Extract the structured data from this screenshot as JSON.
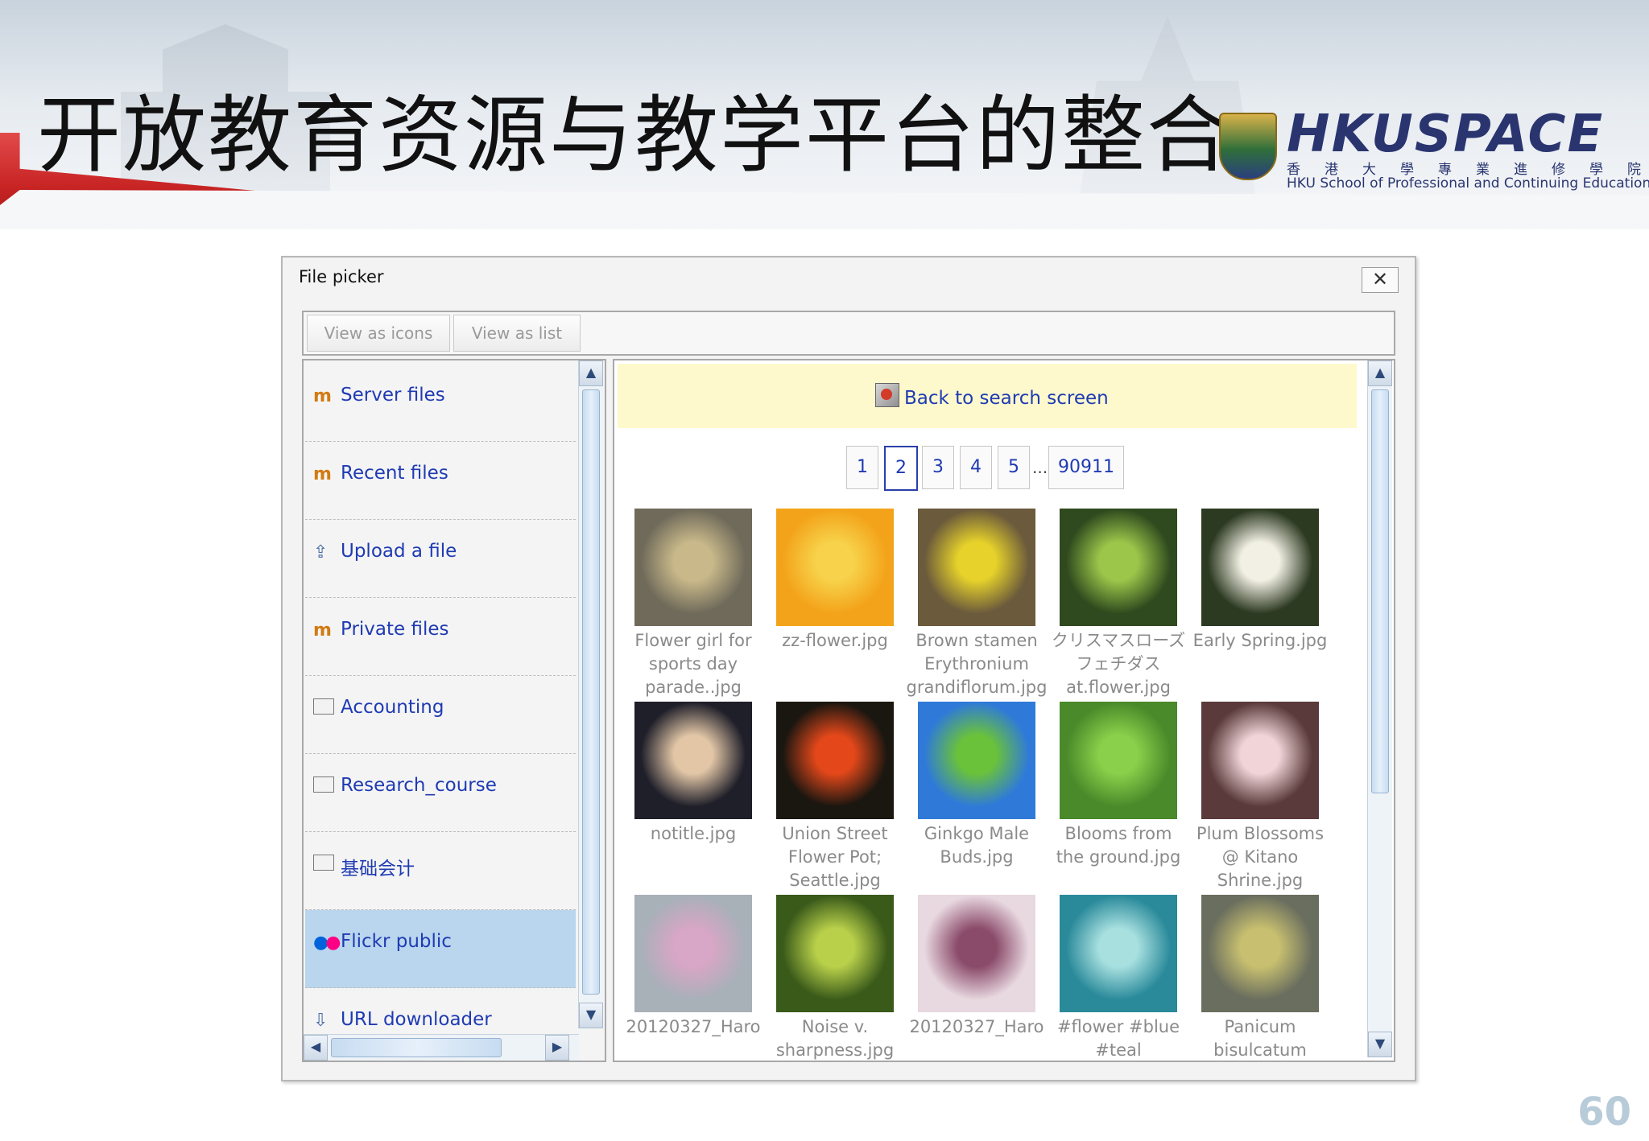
{
  "slide": {
    "title": "开放教育资源与教学平台的整合",
    "logo_text": "HKUSPACE",
    "logo_cn": "香港大學專業進修學院",
    "logo_en": "HKU School of Professional and Continuing Education",
    "page_number": "60"
  },
  "picker": {
    "title": "File picker",
    "close_label": "✕",
    "toolbar": {
      "view_icons": "View as icons",
      "view_list": "View as list"
    },
    "repositories": [
      {
        "label": "Server files",
        "icon": "moodle-icon"
      },
      {
        "label": "Recent files",
        "icon": "moodle-icon"
      },
      {
        "label": "Upload a file",
        "icon": "upload-icon"
      },
      {
        "label": "Private files",
        "icon": "moodle-icon"
      },
      {
        "label": "Accounting",
        "icon": "folder-icon"
      },
      {
        "label": "Research_course",
        "icon": "folder-icon"
      },
      {
        "label": "基础会计",
        "icon": "folder-icon"
      },
      {
        "label": "Flickr public",
        "icon": "flickr-icon",
        "active": true
      },
      {
        "label": "URL downloader",
        "icon": "download-icon"
      }
    ],
    "back_label": "Back to search screen",
    "pages": [
      "1",
      "2",
      "3",
      "4",
      "5"
    ],
    "current_page": "2",
    "ellipsis": "...",
    "last_page": "90911",
    "files": [
      {
        "caption": "Flower girl for\nsports day\nparade..jpg",
        "colors": [
          "#6f6a5a",
          "#c9b98a",
          "#8a8f86"
        ]
      },
      {
        "caption": "zz-flower.jpg",
        "colors": [
          "#f3a31a",
          "#f7d24a",
          "#2d5a1f"
        ]
      },
      {
        "caption": "Brown stamen\nErythronium\ngrandiflorum.jpg",
        "colors": [
          "#6b5a3c",
          "#e6d22a",
          "#8f7a55"
        ]
      },
      {
        "caption": "クリスマスローズ\nフェチダス\nat.flower.jpg",
        "colors": [
          "#2f4a1e",
          "#9bc64a",
          "#5f8a2a"
        ]
      },
      {
        "caption": "Early Spring.jpg",
        "colors": [
          "#2d3a22",
          "#f2f0e4",
          "#7f8f5a"
        ]
      },
      {
        "caption": "notitle.jpg",
        "colors": [
          "#1f1f2a",
          "#e2c6a6",
          "#3a4fb5"
        ]
      },
      {
        "caption": "Union Street\nFlower Pot;\nSeattle.jpg",
        "colors": [
          "#1a1610",
          "#e4481a",
          "#c99a2a"
        ]
      },
      {
        "caption": "Ginkgo Male\nBuds.jpg",
        "colors": [
          "#2f7ad8",
          "#6ac23a",
          "#e6f2fa"
        ]
      },
      {
        "caption": "Blooms from\nthe ground.jpg",
        "colors": [
          "#4a8a2a",
          "#8ad04a",
          "#eef2e8"
        ]
      },
      {
        "caption": "Plum Blossoms\n@ Kitano\nShrine.jpg",
        "colors": [
          "#5a3a3a",
          "#f0d4d8",
          "#3a5aa8"
        ]
      },
      {
        "caption": "20120327_Haro",
        "colors": [
          "#a8b0b8",
          "#d8a6c6",
          "#4a4a42"
        ]
      },
      {
        "caption": "Noise v.\nsharpness.jpg",
        "colors": [
          "#3a5a1a",
          "#b8d04a",
          "#1a2a0a"
        ]
      },
      {
        "caption": "20120327_Haro",
        "colors": [
          "#e8d8e0",
          "#8a4a6a",
          "#4a3a4a"
        ]
      },
      {
        "caption": "#flower #blue\n#teal",
        "colors": [
          "#2a8a9a",
          "#a8e0e0",
          "#f0b020"
        ]
      },
      {
        "caption": "Panicum\nbisulcatum",
        "colors": [
          "#6a6e5e",
          "#c8c070",
          "#4a5042"
        ]
      }
    ]
  }
}
